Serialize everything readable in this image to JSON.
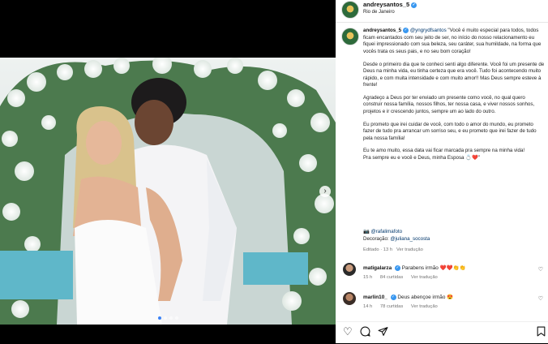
{
  "header": {
    "username": "andreysantos_5",
    "location": "Rio de Janeiro"
  },
  "caption": {
    "username": "andreysantos_5",
    "mention": "@yngrydfsantos",
    "p1": "\"Você é muito especial para todos, todos ficam encantados com seu jeito de ser, no início do nosso relacionamento eu fiquei impressionado com sua beleza, seu caráter, sua humildade, na forma que vocês trata os seus pais, e no seu bom coração!",
    "p2": "Desde o primeiro dia que te conheci senti algo diferente. Você foi um presente de Deus na minha vida, eu tinha certeza que era você. Tudo foi acontecendo muito rápido, e com muita intensidade e com muito amor!! Mas Deus sempre esteve à frente!",
    "p3": "Agradeço a Deus por ter enviado um presente como você, no qual quero construir nossa família, nossos filhos, ter nossa casa, e viver nossos sonhos, projetos e ir crescendo juntos, sempre um ao lado do outro.",
    "p4": "Eu prometo que irei cuidar de você, com todo o amor do mundo, eu prometo fazer de tudo pra arrancar um sorriso seu, e eu prometo que irei fazer de tudo pela nossa família!",
    "p5": "Eu te amo muito, essa data vai ficar marcada pra sempre na minha vida!",
    "p6": "Pra sempre eu e você e Deus, minha Esposa"
  },
  "credits": {
    "photo": "@rafalimafoto",
    "decor_label": "Decoração:",
    "decor": "@juliana_socosta"
  },
  "post_meta": {
    "edited": "Editado · 13 h",
    "translate": "Ver tradução"
  },
  "comments": [
    {
      "username": "matigalarza",
      "text": "Parabens irmão",
      "emojis": "❤️❤️👏👏",
      "time": "15 h",
      "likes": "84 curtidas",
      "translate": "Ver tradução"
    },
    {
      "username": "marlin10_",
      "text": "Deus abençoe irmão",
      "emojis": "😍",
      "time": "14 h",
      "likes": "78 curtidas",
      "translate": "Ver tradução"
    }
  ],
  "icons": {
    "like": "heart-icon",
    "comment": "comment-icon",
    "share": "send-icon",
    "save": "bookmark-icon"
  },
  "colors": {
    "link": "#00376b",
    "verified": "#3897f0",
    "meta": "#737373"
  }
}
